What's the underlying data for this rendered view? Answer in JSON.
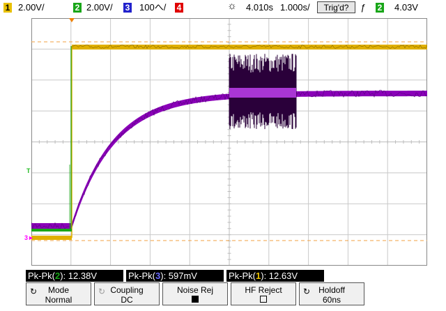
{
  "status_bar": {
    "ch1": {
      "num": "1",
      "scale": "2.00V/",
      "color": "#e8c000"
    },
    "ch2": {
      "num": "2",
      "scale": "2.00V/",
      "color": "#19a619"
    },
    "ch3": {
      "num": "3",
      "scale": "100へ/",
      "color": "#2222cc"
    },
    "ch4": {
      "num": "4",
      "color": "#e00000"
    },
    "trigger_position": "4.010s",
    "timebase": "1.000s/",
    "trig_status": "Trig'd?",
    "trig_channel": "2",
    "trig_level": "4.03V"
  },
  "measurements": [
    {
      "prefix": "Pk-Pk(",
      "channel": "2",
      "suffix": "): 12.38V",
      "color": "#19a619"
    },
    {
      "prefix": "Pk-Pk(",
      "channel": "3",
      "suffix": "): 597mV",
      "color": "#4444ff"
    },
    {
      "prefix": "Pk-Pk(",
      "channel": "1",
      "suffix": "): 12.63V",
      "color": "#e8c000"
    }
  ],
  "softkeys": {
    "mode": {
      "label": "Mode",
      "value": "Normal"
    },
    "coupling": {
      "label": "Coupling",
      "value": "DC"
    },
    "noise_rej": {
      "label": "Noise Rej",
      "checked": true
    },
    "hf_reject": {
      "label": "HF Reject",
      "checked": false
    },
    "holdoff": {
      "label": "Holdoff",
      "value": "60ns"
    }
  },
  "markers": {
    "trigger": "T",
    "ch3": "3"
  }
}
